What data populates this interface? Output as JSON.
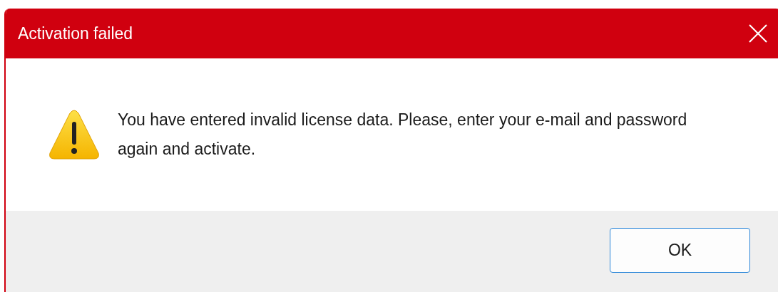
{
  "window": {
    "title": "Activation failed"
  },
  "message": "You have entered invalid license data. Please, enter your e-mail and password again and activate.",
  "buttons": [
    "OK"
  ]
}
